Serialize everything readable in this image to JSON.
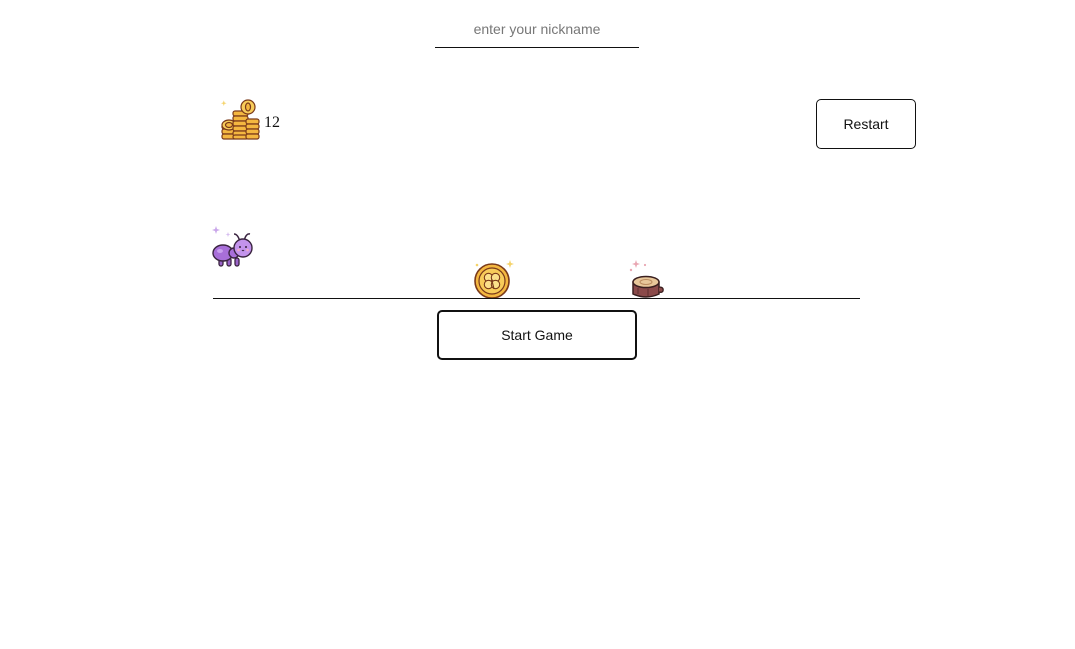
{
  "nickname": {
    "placeholder": "enter your nickname",
    "value": ""
  },
  "score": {
    "coins": "12",
    "icon": "coin-stack-icon"
  },
  "controls": {
    "restart_label": "Restart",
    "start_label": "Start Game"
  },
  "scene": {
    "player": "ant-icon",
    "items": [
      "clover-coin-icon",
      "tree-stump-icon"
    ]
  }
}
